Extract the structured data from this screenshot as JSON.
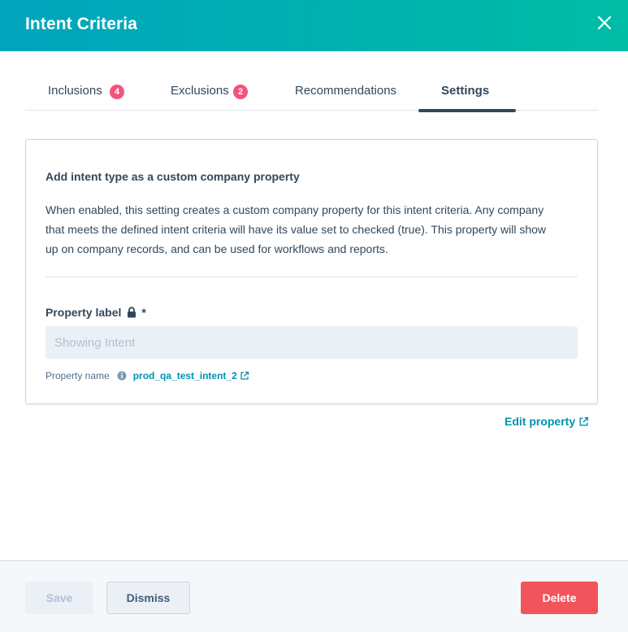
{
  "header": {
    "title": "Intent Criteria",
    "close_icon": "close-icon"
  },
  "tabs": [
    {
      "label": "Inclusions",
      "badge": "4",
      "active": false
    },
    {
      "label": "Exclusions",
      "badge": "2",
      "active": false
    },
    {
      "label": "Recommendations",
      "badge": null,
      "active": false
    },
    {
      "label": "Settings",
      "badge": null,
      "active": true
    }
  ],
  "settings": {
    "title": "Add intent type as a custom company property",
    "description": "When enabled, this setting creates a custom company property for this intent criteria. Any company that meets the defined intent criteria will have its value set to checked (true). This property will show up on company records, and can be used for workflows and reports.",
    "property_label": "Property label",
    "required_marker": "*",
    "property_label_placeholder": "Showing Intent",
    "property_name_label": "Property name",
    "property_name_value": "prod_qa_test_intent_2",
    "edit_property_label": "Edit property"
  },
  "footer": {
    "save_label": "Save",
    "dismiss_label": "Dismiss",
    "delete_label": "Delete"
  },
  "colors": {
    "header_gradient_start": "#00a4bd",
    "header_gradient_end": "#00bda5",
    "badge": "#f2547d",
    "link": "#0091ae",
    "delete": "#f2545b",
    "text": "#33475b"
  }
}
